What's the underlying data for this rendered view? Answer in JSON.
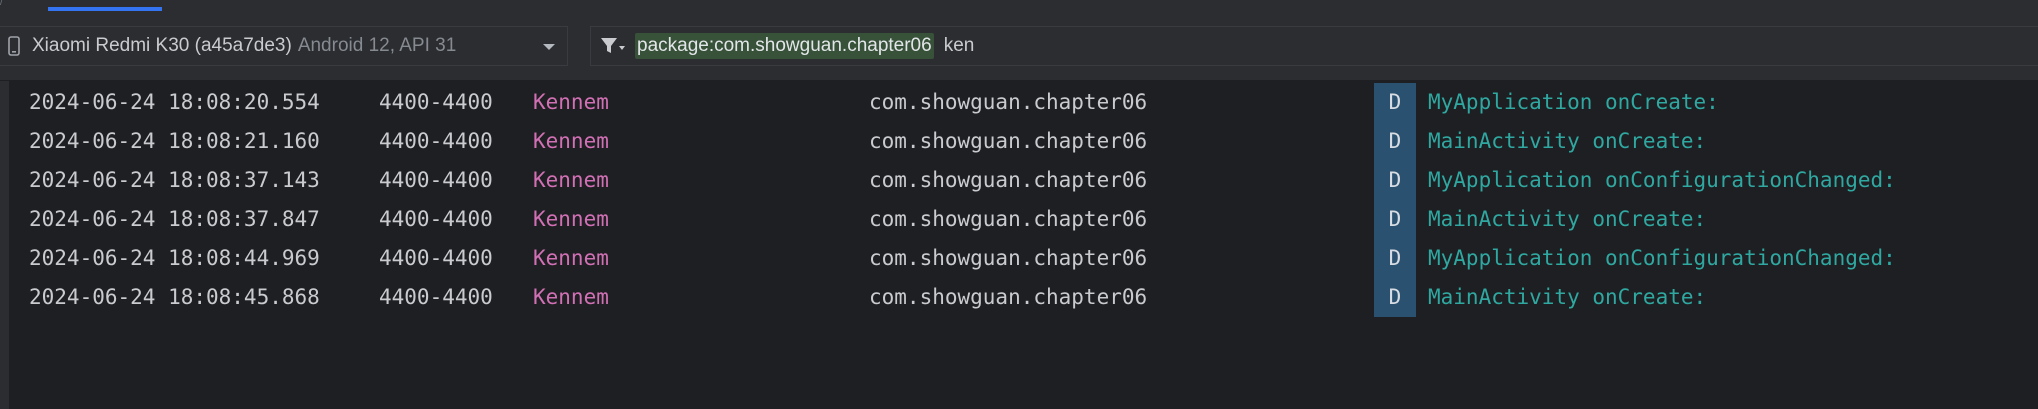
{
  "device": {
    "name": "Xiaomi Redmi K30 (a45a7de3)",
    "api": "Android 12, API 31",
    "icon": "phone-icon"
  },
  "filter": {
    "chip": "package:com.showguan.chapter06",
    "text": "ken"
  },
  "colors": {
    "tag": "#d270b5",
    "message": "#2fa8a1",
    "level_bg": "#2b5170",
    "chip_bg": "#375239"
  },
  "logs": [
    {
      "time": "2024-06-24 18:08:20.554",
      "pid": "4400-4400",
      "tag": "Kennem",
      "package": "com.showguan.chapter06",
      "level": "D",
      "message": "MyApplication onCreate:"
    },
    {
      "time": "2024-06-24 18:08:21.160",
      "pid": "4400-4400",
      "tag": "Kennem",
      "package": "com.showguan.chapter06",
      "level": "D",
      "message": "MainActivity onCreate:"
    },
    {
      "time": "2024-06-24 18:08:37.143",
      "pid": "4400-4400",
      "tag": "Kennem",
      "package": "com.showguan.chapter06",
      "level": "D",
      "message": "MyApplication onConfigurationChanged:"
    },
    {
      "time": "2024-06-24 18:08:37.847",
      "pid": "4400-4400",
      "tag": "Kennem",
      "package": "com.showguan.chapter06",
      "level": "D",
      "message": "MainActivity onCreate:"
    },
    {
      "time": "2024-06-24 18:08:44.969",
      "pid": "4400-4400",
      "tag": "Kennem",
      "package": "com.showguan.chapter06",
      "level": "D",
      "message": "MyApplication onConfigurationChanged:"
    },
    {
      "time": "2024-06-24 18:08:45.868",
      "pid": "4400-4400",
      "tag": "Kennem",
      "package": "com.showguan.chapter06",
      "level": "D",
      "message": "MainActivity onCreate:"
    }
  ]
}
